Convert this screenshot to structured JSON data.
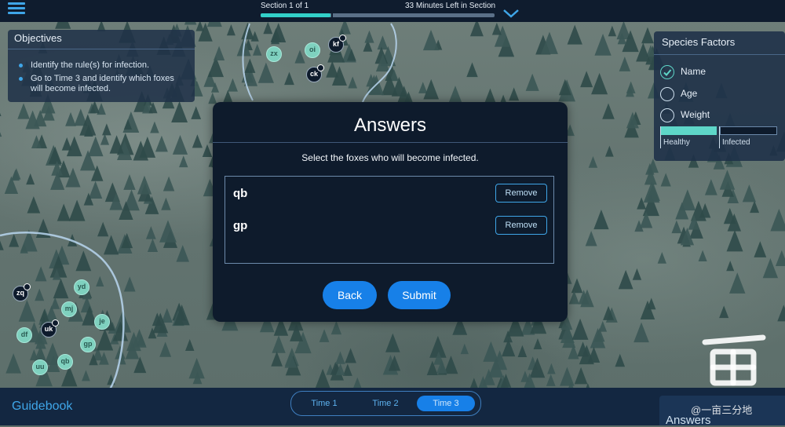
{
  "header": {
    "section_label": "Section 1 of 1",
    "time_left": "33 Minutes Left in Section",
    "progress_fraction": 0.3
  },
  "objectives": {
    "title": "Objectives",
    "items": [
      {
        "text": "Identify the rule(s) for infection."
      },
      {
        "text": "Go to Time 3 and identify which foxes will become infected."
      }
    ]
  },
  "species_factors": {
    "title": "Species Factors",
    "options": [
      {
        "label": "Name",
        "checked": true
      },
      {
        "label": "Age",
        "checked": false
      },
      {
        "label": "Weight",
        "checked": false
      }
    ],
    "legend": {
      "healthy": "Healthy",
      "infected": "Infected"
    }
  },
  "modal": {
    "title": "Answers",
    "subtitle": "Select the foxes who will become infected.",
    "answers": [
      {
        "name": "qb",
        "remove_label": "Remove"
      },
      {
        "name": "gp",
        "remove_label": "Remove"
      }
    ],
    "back_label": "Back",
    "submit_label": "Submit"
  },
  "foxes": [
    {
      "label": "zx",
      "status": "healthy"
    },
    {
      "label": "oi",
      "status": "healthy"
    },
    {
      "label": "kf",
      "status": "infected"
    },
    {
      "label": "ck",
      "status": "infected"
    },
    {
      "label": "zq",
      "status": "infected"
    },
    {
      "label": "yd",
      "status": "healthy"
    },
    {
      "label": "mj",
      "status": "healthy"
    },
    {
      "label": "je",
      "status": "healthy"
    },
    {
      "label": "df",
      "status": "healthy"
    },
    {
      "label": "uk",
      "status": "infected"
    },
    {
      "label": "gp",
      "status": "healthy"
    },
    {
      "label": "uu",
      "status": "healthy"
    },
    {
      "label": "qb",
      "status": "healthy"
    }
  ],
  "bottom": {
    "guidebook": "Guidebook",
    "time_tabs": [
      {
        "label": "Time 1",
        "active": false
      },
      {
        "label": "Time 2",
        "active": false
      },
      {
        "label": "Time 3",
        "active": true
      }
    ],
    "answers_tab": "Answers"
  },
  "watermark": "@一亩三分地",
  "colors": {
    "accent": "#1780e8",
    "healthy": "#5ed6c8",
    "infected": "#0e1b2c",
    "panel": "#1e3048"
  }
}
